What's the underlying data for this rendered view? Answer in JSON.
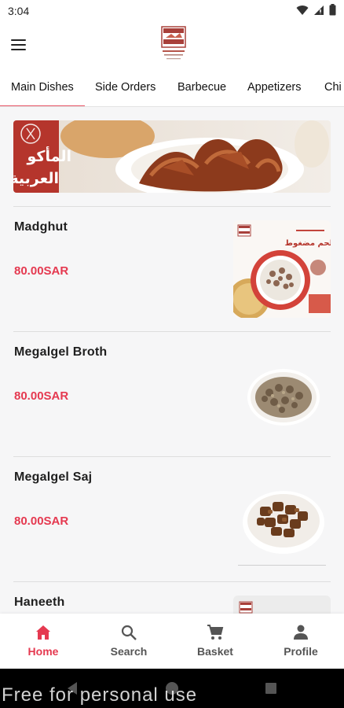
{
  "status_bar": {
    "time": "3:04"
  },
  "app_bar": {
    "logo_alt": "restaurant-logo"
  },
  "tabs": [
    {
      "label": "Main Dishes",
      "active": true
    },
    {
      "label": "Side Orders",
      "active": false
    },
    {
      "label": "Barbecue",
      "active": false
    },
    {
      "label": "Appetizers",
      "active": false
    },
    {
      "label": "Chi",
      "active": false
    }
  ],
  "banner": {
    "title_line1": "المأكو",
    "title_line2": "العربية"
  },
  "dishes": [
    {
      "name": "Madghut",
      "price": "80.00SAR"
    },
    {
      "name": "Megalgel Broth",
      "price": "80.00SAR"
    },
    {
      "name": "Megalgel Saj",
      "price": "80.00SAR"
    },
    {
      "name": "Haneeth",
      "price": ""
    }
  ],
  "madghut_photo": {
    "caption": "لحم مضغوط"
  },
  "bottom_nav": [
    {
      "label": "Home",
      "icon": "home-icon",
      "active": true
    },
    {
      "label": "Search",
      "icon": "search-icon",
      "active": false
    },
    {
      "label": "Basket",
      "icon": "cart-icon",
      "active": false
    },
    {
      "label": "Profile",
      "icon": "person-icon",
      "active": false
    }
  ],
  "watermark": "Free for personal use",
  "colors": {
    "accent": "#e53950",
    "tab_indicator": "#e85466",
    "banner_red": "#b5352c"
  }
}
